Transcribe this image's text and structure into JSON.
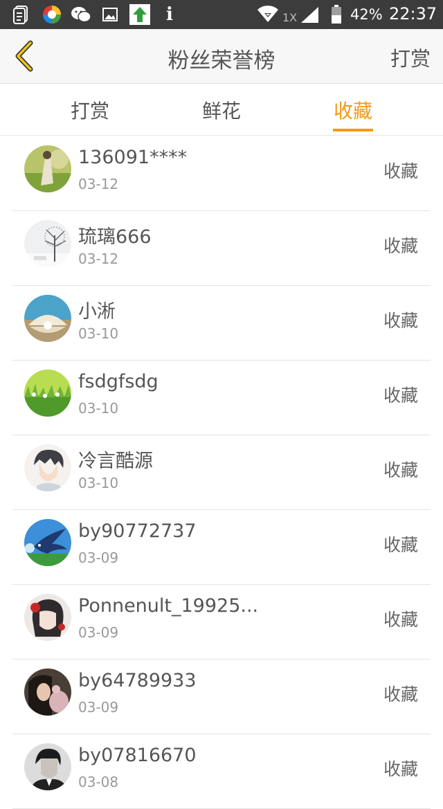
{
  "status_bar": {
    "battery": "42%",
    "time": "22:37",
    "network_label": "1X"
  },
  "header": {
    "title": "粉丝荣誉榜",
    "action_label": "打赏"
  },
  "tabs": [
    {
      "label": "打赏",
      "active": false
    },
    {
      "label": "鲜花",
      "active": false
    },
    {
      "label": "收藏",
      "active": true
    }
  ],
  "accent_color": "#f39a17",
  "fans": [
    {
      "name": "136091****",
      "date": "03-12",
      "action": "收藏"
    },
    {
      "name": "琉璃666",
      "date": "03-12",
      "action": "收藏"
    },
    {
      "name": "小淅",
      "date": "03-10",
      "action": "收藏"
    },
    {
      "name": "fsdgfsdg",
      "date": "03-10",
      "action": "收藏"
    },
    {
      "name": "冷言酷源",
      "date": "03-10",
      "action": "收藏"
    },
    {
      "name": "by90772737",
      "date": "03-09",
      "action": "收藏"
    },
    {
      "name": "Ponnenult_19925...",
      "date": "03-09",
      "action": "收藏"
    },
    {
      "name": "by64789933",
      "date": "03-09",
      "action": "收藏"
    },
    {
      "name": "by07816670",
      "date": "03-08",
      "action": "收藏"
    }
  ]
}
